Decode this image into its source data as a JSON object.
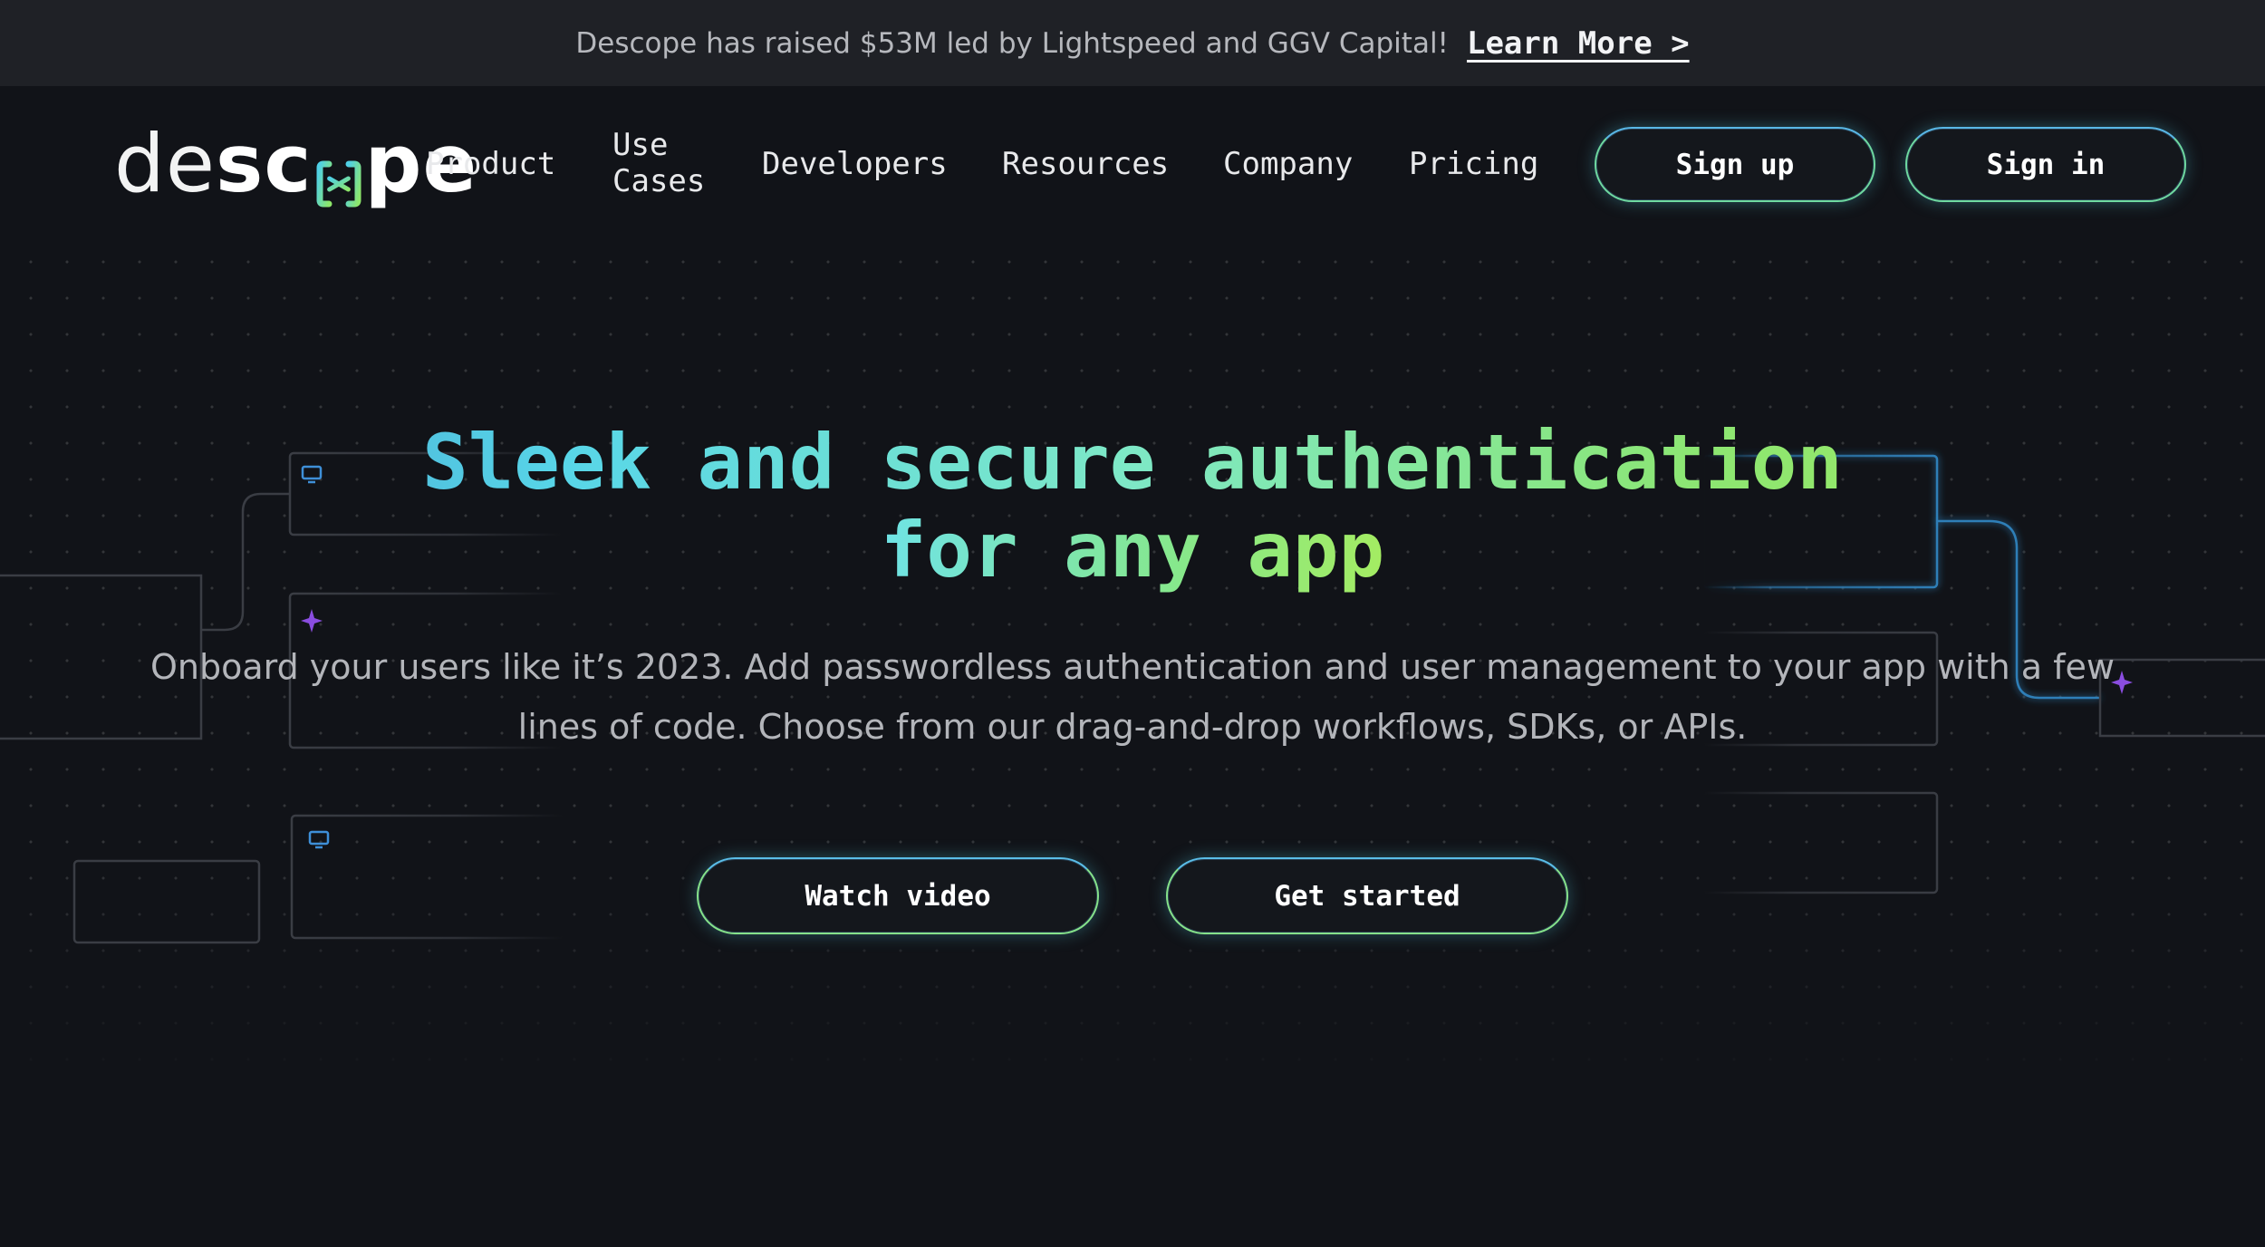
{
  "announcement": {
    "text": "Descope has raised $53M led by Lightspeed and GGV Capital!",
    "link_label": "Learn More >"
  },
  "header": {
    "logo": {
      "part1": "de",
      "part2": "sc",
      "part3": "pe"
    },
    "nav": [
      {
        "label": "Product"
      },
      {
        "label_line1": "Use",
        "label_line2": "Cases"
      },
      {
        "label": "Developers"
      },
      {
        "label": "Resources"
      },
      {
        "label": "Company"
      },
      {
        "label": "Pricing"
      }
    ],
    "signup_label": "Sign up",
    "signin_label": "Sign in"
  },
  "hero": {
    "title_line1": "Sleek and secure authentication",
    "title_line2": "for any app",
    "subtitle_line1": "Onboard your users like it’s 2023. Add passwordless authentication and user management to your app with a few",
    "subtitle_line2": "lines of code. Choose from our drag-and-drop workflows, SDKs, or APIs.",
    "watch_video_label": "Watch video",
    "get_started_label": "Get started"
  },
  "colors": {
    "background": "#111318",
    "announcement_bg": "#1f2126",
    "accent_blue": "#3e8fc8",
    "accent_green": "#a6ec5a"
  },
  "icons": [
    "monitor-icon",
    "sparkle-icon",
    "logo-mark-icon"
  ]
}
